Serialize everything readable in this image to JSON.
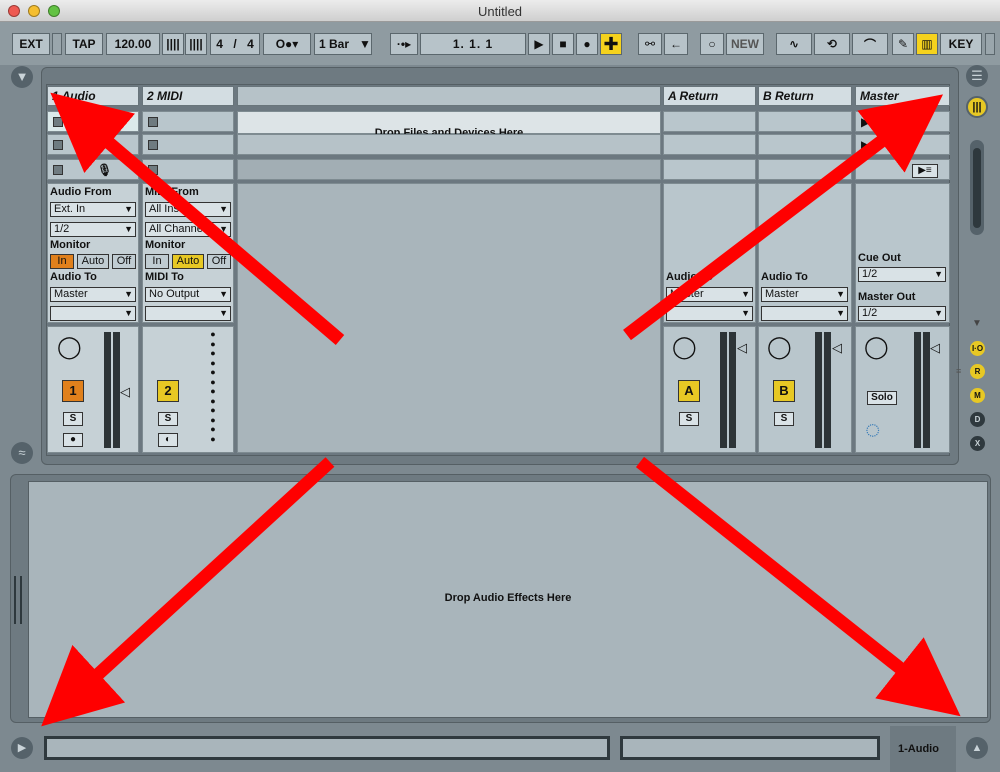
{
  "window": {
    "title": "Untitled"
  },
  "toolbar": {
    "ext": "EXT",
    "tap": "TAP",
    "tempo": "120.00",
    "signature_num": "4",
    "signature_den": "4",
    "quantize": "1 Bar",
    "position": "1.   1.   1",
    "new": "NEW",
    "key": "KEY"
  },
  "tracks": [
    {
      "name": "1 Audio",
      "number": "1",
      "color": "#e0801c",
      "solo": "S",
      "from_label": "Audio From",
      "from_value": "Ext. In",
      "from_channel": "1/2",
      "monitor_label": "Monitor",
      "monitor": [
        "In",
        "Auto",
        "Off"
      ],
      "monitor_active": "In",
      "to_label": "Audio To",
      "to_value": "Master"
    },
    {
      "name": "2 MIDI",
      "number": "2",
      "color": "#e7c824",
      "solo": "S",
      "from_label": "MIDI From",
      "from_value": "All Ins",
      "from_channel": "All Channels",
      "monitor_label": "Monitor",
      "monitor": [
        "In",
        "Auto",
        "Off"
      ],
      "monitor_active": "Auto",
      "to_label": "MIDI To",
      "to_value": "No Output"
    }
  ],
  "session": {
    "drop_label": "Drop Files and Devices Here"
  },
  "returns": [
    {
      "name": "A Return",
      "letter": "A",
      "solo": "S",
      "to_label": "Audio To",
      "to_value": "Master"
    },
    {
      "name": "B Return",
      "letter": "B",
      "solo": "S",
      "to_label": "Audio To",
      "to_value": "Master"
    }
  ],
  "master": {
    "name": "Master",
    "cue_label": "Cue Out",
    "cue_value": "1/2",
    "out_label": "Master Out",
    "out_value": "1/2",
    "solo": "Solo"
  },
  "right_sidebar": {
    "buttons": [
      "I·O",
      "R",
      "M",
      "D",
      "X"
    ]
  },
  "device": {
    "drop_label": "Drop Audio Effects Here"
  },
  "status": {
    "track": "1-Audio"
  },
  "colors": {
    "accent": "#f5d21d",
    "arrow": "#ff0000"
  }
}
